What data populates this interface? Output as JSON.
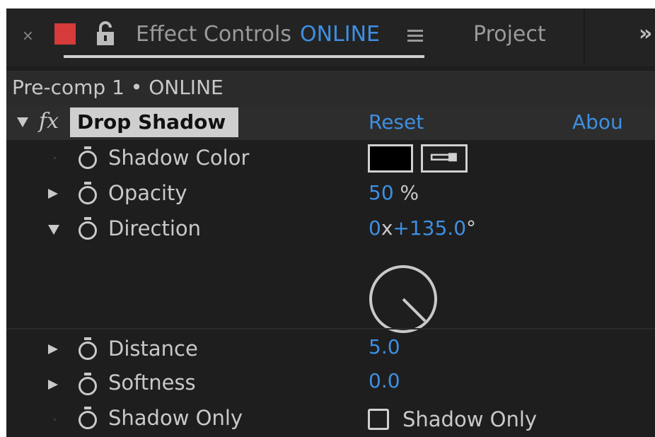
{
  "tab": {
    "close_glyph": "×",
    "label_color": "#d63a3a",
    "title": "Effect Controls",
    "comp_name": "ONLINE",
    "other_tab": "Project",
    "overflow_glyph": "»"
  },
  "comp_line": "Pre-comp 1 • ONLINE",
  "effect": {
    "name": "Drop Shadow",
    "fx_glyph": "fx",
    "reset_label": "Reset",
    "about_label": "Abou"
  },
  "properties": {
    "shadow_color": {
      "label": "Shadow Color",
      "value_color": "#000000"
    },
    "opacity": {
      "label": "Opacity",
      "value": "50",
      "unit": "%"
    },
    "direction": {
      "label": "Direction",
      "revolutions": "0",
      "x": "x",
      "degrees": "+135.0",
      "unit": "°"
    },
    "distance": {
      "label": "Distance",
      "value": "5.0"
    },
    "softness": {
      "label": "Softness",
      "value": "0.0"
    },
    "shadow_only": {
      "label": "Shadow Only",
      "checkbox_label": "Shadow Only",
      "checked": false
    }
  },
  "icons": {
    "stopwatch": "stopwatch-icon",
    "twirl_closed": "triangle-right-icon",
    "twirl_open": "triangle-down-icon",
    "eyedropper": "eyedropper-icon",
    "lock": "lock-icon",
    "panel_menu": "hamburger-icon"
  },
  "colors": {
    "accent": "#3e8fe2",
    "panel_bg": "#1e1e1e",
    "text": "#c9c9c9"
  }
}
